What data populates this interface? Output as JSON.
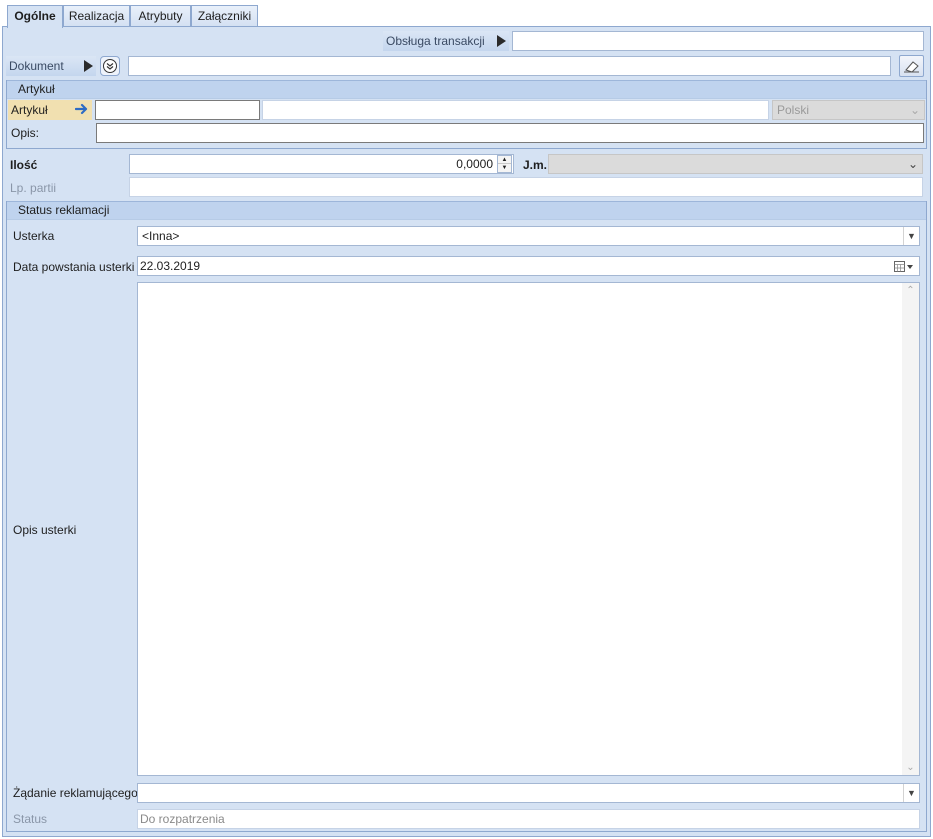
{
  "tabs": [
    {
      "label": "Ogólne",
      "active": true
    },
    {
      "label": "Realizacja",
      "active": false
    },
    {
      "label": "Atrybuty",
      "active": false
    },
    {
      "label": "Załączniki",
      "active": false
    }
  ],
  "transaction": {
    "label": "Obsługa transakcji",
    "value": ""
  },
  "document": {
    "label": "Dokument",
    "value": ""
  },
  "article_group": {
    "header": "Artykuł",
    "article_label": "Artykuł",
    "article_code": "",
    "article_name": "",
    "language": "Polski",
    "description_label": "Opis:",
    "description_value": ""
  },
  "quantity": {
    "label": "Ilość",
    "value": "0,0000",
    "unit_label": "J.m.",
    "unit_value": ""
  },
  "batch": {
    "label": "Lp. partii",
    "value": ""
  },
  "status_group": {
    "header": "Status reklamacji",
    "defect_label": "Usterka",
    "defect_value": "<Inna>",
    "date_label": "Data powstania usterki",
    "date_value": "22.03.2019",
    "description_label": "Opis usterki",
    "description_value": "",
    "demand_label": "Żądanie reklamującego",
    "demand_value": "",
    "status_label": "Status",
    "status_value": "Do rozpatrzenia"
  },
  "colors": {
    "panel_bg": "#d5e2f3",
    "border": "#8ea8cf",
    "group_header_bg": "#bfd3ee",
    "article_label_bg": "#f1e0b0",
    "arrow_blue": "#2f6cc4"
  }
}
